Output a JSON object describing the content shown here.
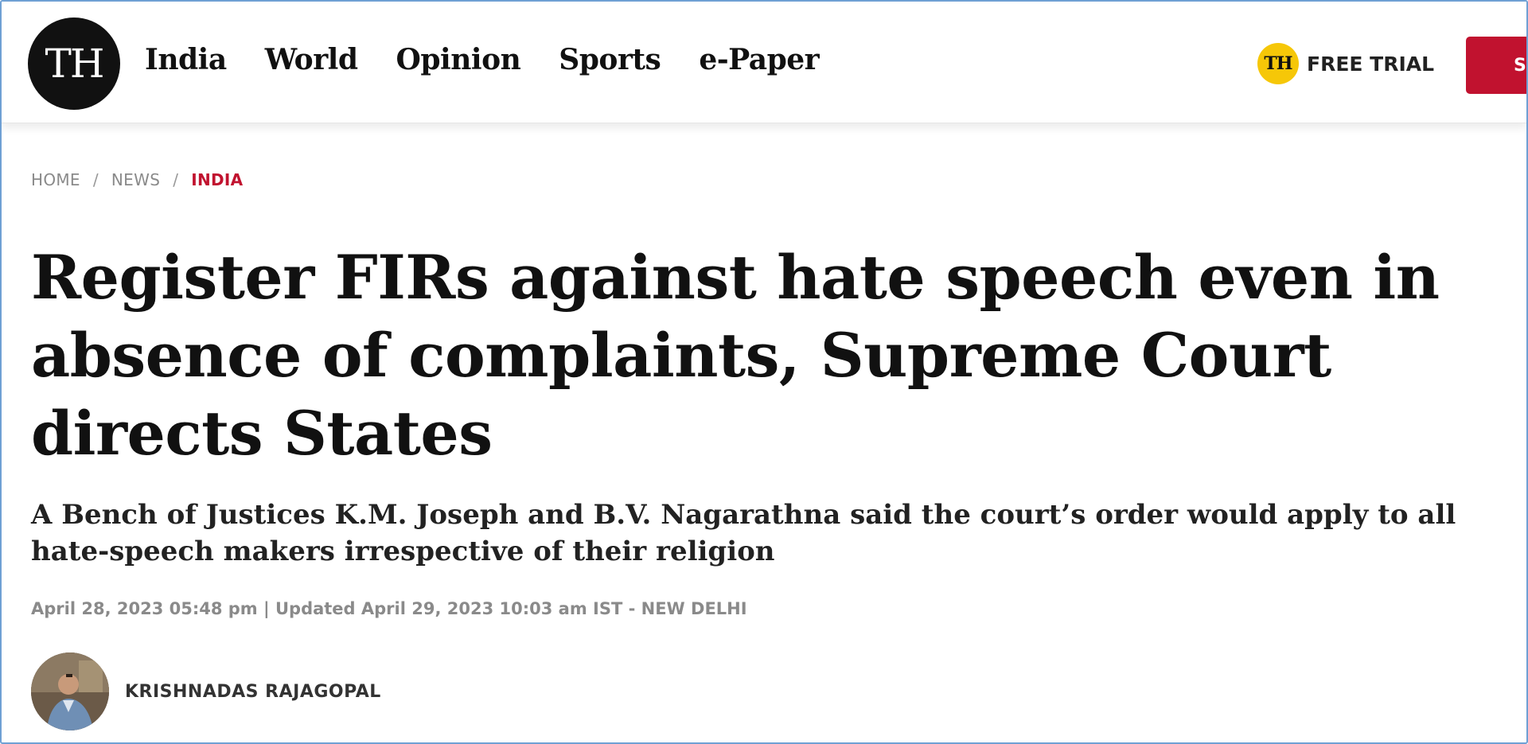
{
  "header": {
    "logo_text": "TH",
    "nav": [
      "India",
      "World",
      "Opinion",
      "Sports",
      "e-Paper"
    ],
    "free_trial_badge": "TH",
    "free_trial_label": "FREE TRIAL",
    "subscribe_label": "S"
  },
  "breadcrumb": {
    "items": [
      "HOME",
      "NEWS",
      "INDIA"
    ],
    "separator": "/"
  },
  "article": {
    "headline": "Register FIRs against hate speech even in absence of complaints, Supreme Court directs States",
    "subheadline": "A Bench of Justices K.M. Joseph and B.V. Nagarathna said the court’s order would apply to all hate-speech makers irrespective of their religion",
    "dateline": "April 28, 2023 05:48 pm | Updated April 29, 2023 10:03 am IST - NEW DELHI",
    "author": "KRISHNADAS RAJAGOPAL"
  },
  "colors": {
    "accent": "#c1122f",
    "badge": "#f6c708",
    "frame": "#6fa0d4"
  }
}
